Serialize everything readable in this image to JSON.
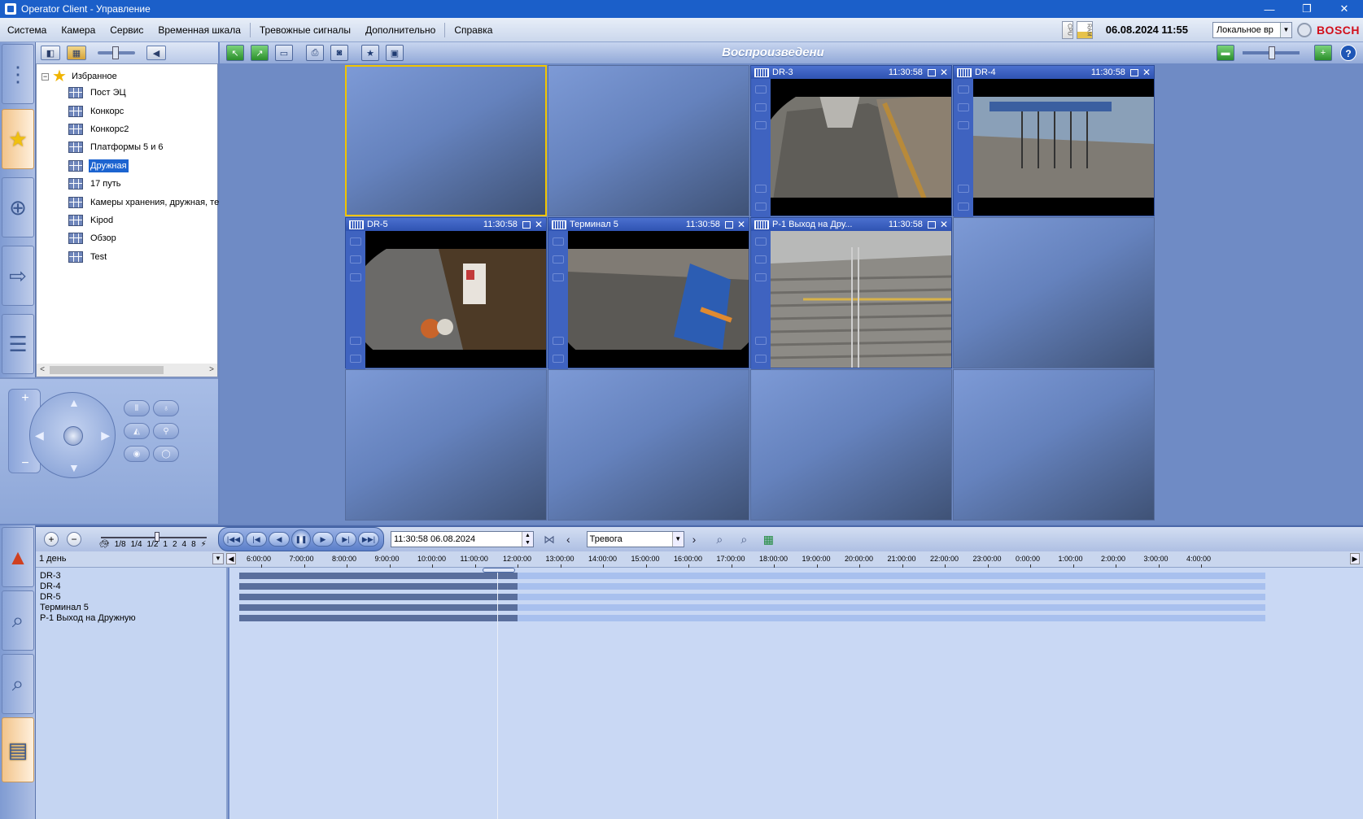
{
  "window": {
    "title": "Operator Client - Управление",
    "minimize": "—",
    "restore": "❐",
    "close": "✕"
  },
  "menu": {
    "items": [
      "Система",
      "Камера",
      "Сервис",
      "Временная шкала",
      "Тревожные сигналы",
      "Дополнительно",
      "Справка"
    ],
    "cpu_label": "CPU",
    "ram_label": "RAM",
    "datetime": "06.08.2024 11:55",
    "timezone": "Локальное вр",
    "brand": "BOSCH"
  },
  "left_nav": {
    "active": "favorites"
  },
  "tree": {
    "root_label": "Избранное",
    "expander": "−",
    "items": [
      {
        "label": "Пост ЭЦ"
      },
      {
        "label": "Конкорс"
      },
      {
        "label": "Конкорс2"
      },
      {
        "label": "Платформы 5 и 6"
      },
      {
        "label": "Дружная",
        "selected": true
      },
      {
        "label": "17 путь"
      },
      {
        "label": "Камеры хранения, дружная, те"
      },
      {
        "label": "Kipod"
      },
      {
        "label": "Обзор"
      },
      {
        "label": "Test"
      }
    ],
    "scroll_left": "<",
    "scroll_right": ">"
  },
  "ptz": {
    "zoom_in": "+",
    "zoom_out": "−"
  },
  "main_toolbar": {
    "mode_title": "Воспроизведени"
  },
  "panes": [
    {
      "id": "p1",
      "empty": true,
      "selected": true
    },
    {
      "id": "p2",
      "empty": true
    },
    {
      "id": "p3",
      "name": "DR-3",
      "time": "11:30:58"
    },
    {
      "id": "p4",
      "name": "DR-4",
      "time": "11:30:58"
    },
    {
      "id": "p5",
      "name": "DR-5",
      "time": "11:30:58"
    },
    {
      "id": "p6",
      "name": "Терминал 5",
      "time": "11:30:58"
    },
    {
      "id": "p7",
      "name": "P-1 Выход на Дру...",
      "time": "11:30:58"
    },
    {
      "id": "p8",
      "empty": true
    },
    {
      "id": "p9",
      "empty": true
    },
    {
      "id": "p10",
      "empty": true
    },
    {
      "id": "p11",
      "empty": true
    },
    {
      "id": "p12",
      "empty": true
    }
  ],
  "pane_close": "✕",
  "timeline": {
    "zoom_in": "+",
    "zoom_out": "−",
    "speed_labels": [
      "1/8",
      "1/4",
      "1/2",
      "1",
      "2",
      "4",
      "8"
    ],
    "current": "11:30:58  06.08.2024",
    "event_type": "Тревога",
    "span": "1 день",
    "ticks": [
      "6:00:00",
      "7:00:00",
      "8:00:00",
      "9:00:00",
      "10:00:00",
      "11:00:00",
      "12:00:00",
      "13:00:00",
      "14:00:00",
      "15:00:00",
      "16:00:00",
      "17:00:00",
      "18:00:00",
      "19:00:00",
      "20:00:00",
      "21:00:00",
      "22:00:00",
      "23:00:00",
      "0:00:00",
      "1:00:00",
      "2:00:00",
      "3:00:00",
      "4:00:00"
    ],
    "cameras": [
      "DR-3",
      "DR-4",
      "DR-5",
      "Терминал 5",
      "P-1 Выход на Дружную"
    ],
    "recording_end": "12:00:00",
    "cursor_time": "11:30:58"
  },
  "colors": {
    "accent": "#1b5fc9",
    "selected_pane": "#f0c400",
    "brand": "#d20f1b"
  }
}
